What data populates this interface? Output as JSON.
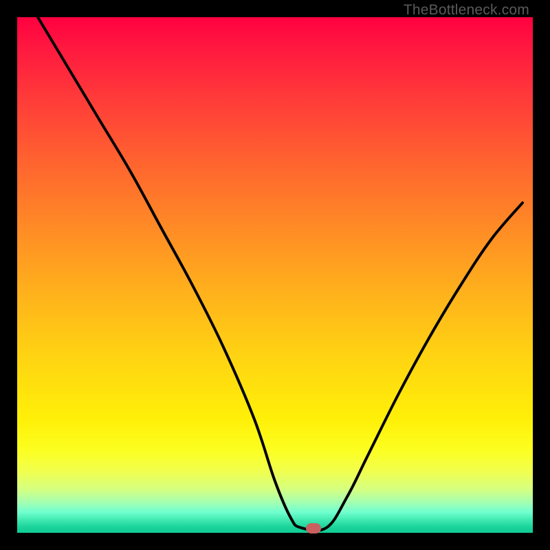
{
  "watermark": "TheBottleneck.com",
  "chart_data": {
    "type": "line",
    "title": "",
    "xlabel": "",
    "ylabel": "",
    "xlim": [
      0,
      100
    ],
    "ylim": [
      0,
      100
    ],
    "series": [
      {
        "name": "curve",
        "x": [
          4,
          10,
          16,
          22,
          28,
          34,
          40,
          46,
          50,
          53,
          55,
          60,
          64,
          68,
          74,
          80,
          86,
          92,
          98
        ],
        "y": [
          100,
          90,
          80,
          70,
          59,
          48,
          36,
          22,
          10,
          3,
          1,
          1,
          7,
          15,
          27,
          38,
          48,
          57,
          64
        ]
      }
    ],
    "marker": {
      "x": 57.5,
      "y": 1
    },
    "gradient_stops": [
      {
        "pos": 0,
        "color": "#ff0040"
      },
      {
        "pos": 50,
        "color": "#ffc018"
      },
      {
        "pos": 80,
        "color": "#fff008"
      },
      {
        "pos": 100,
        "color": "#10cc95"
      }
    ]
  }
}
